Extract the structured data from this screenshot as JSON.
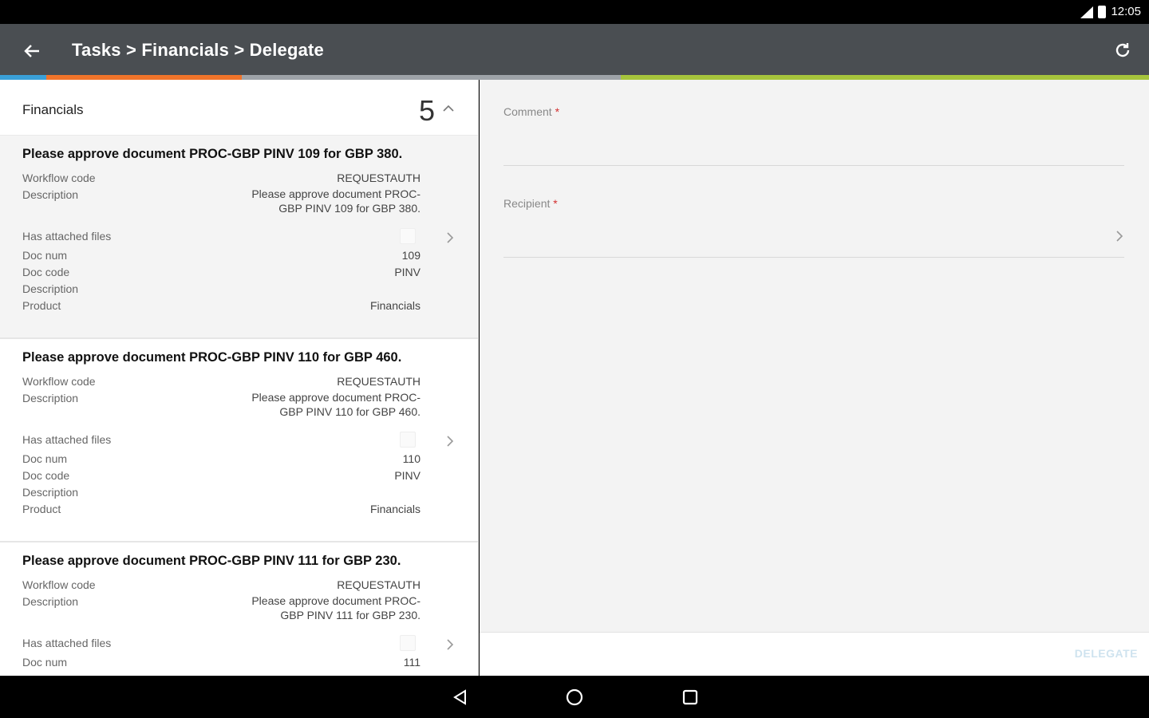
{
  "status": {
    "time": "12:05"
  },
  "appbar": {
    "title": "Tasks > Financials > Delegate"
  },
  "strip_colors": [
    "#3aa0d8",
    "#f0742a",
    "#9ea3a8",
    "#a6c43c"
  ],
  "list": {
    "group_title": "Financials",
    "group_count": "5",
    "labels": {
      "workflow_code": "Workflow code",
      "description": "Description",
      "has_files": "Has attached files",
      "doc_num": "Doc num",
      "doc_code": "Doc code",
      "description2": "Description",
      "product": "Product"
    },
    "items": [
      {
        "title": "Please approve document PROC-GBP PINV 109 for GBP 380.",
        "workflow_code": "REQUESTAUTH",
        "description": "Please approve document PROC-GBP PINV 109 for GBP 380.",
        "doc_num": "109",
        "doc_code": "PINV",
        "product": "Financials"
      },
      {
        "title": "Please approve document PROC-GBP PINV 110 for GBP 460.",
        "workflow_code": "REQUESTAUTH",
        "description": "Please approve document PROC-GBP PINV 110 for GBP 460.",
        "doc_num": "110",
        "doc_code": "PINV",
        "product": "Financials"
      },
      {
        "title": "Please approve document PROC-GBP PINV 111 for GBP 230.",
        "workflow_code": "REQUESTAUTH",
        "description": "Please approve document PROC-GBP PINV 111 for GBP 230.",
        "doc_num": "111",
        "doc_code": "",
        "product": ""
      }
    ]
  },
  "form": {
    "comment_label": "Comment",
    "recipient_label": "Recipient",
    "required_mark": "*",
    "delegate_label": "DELEGATE"
  }
}
